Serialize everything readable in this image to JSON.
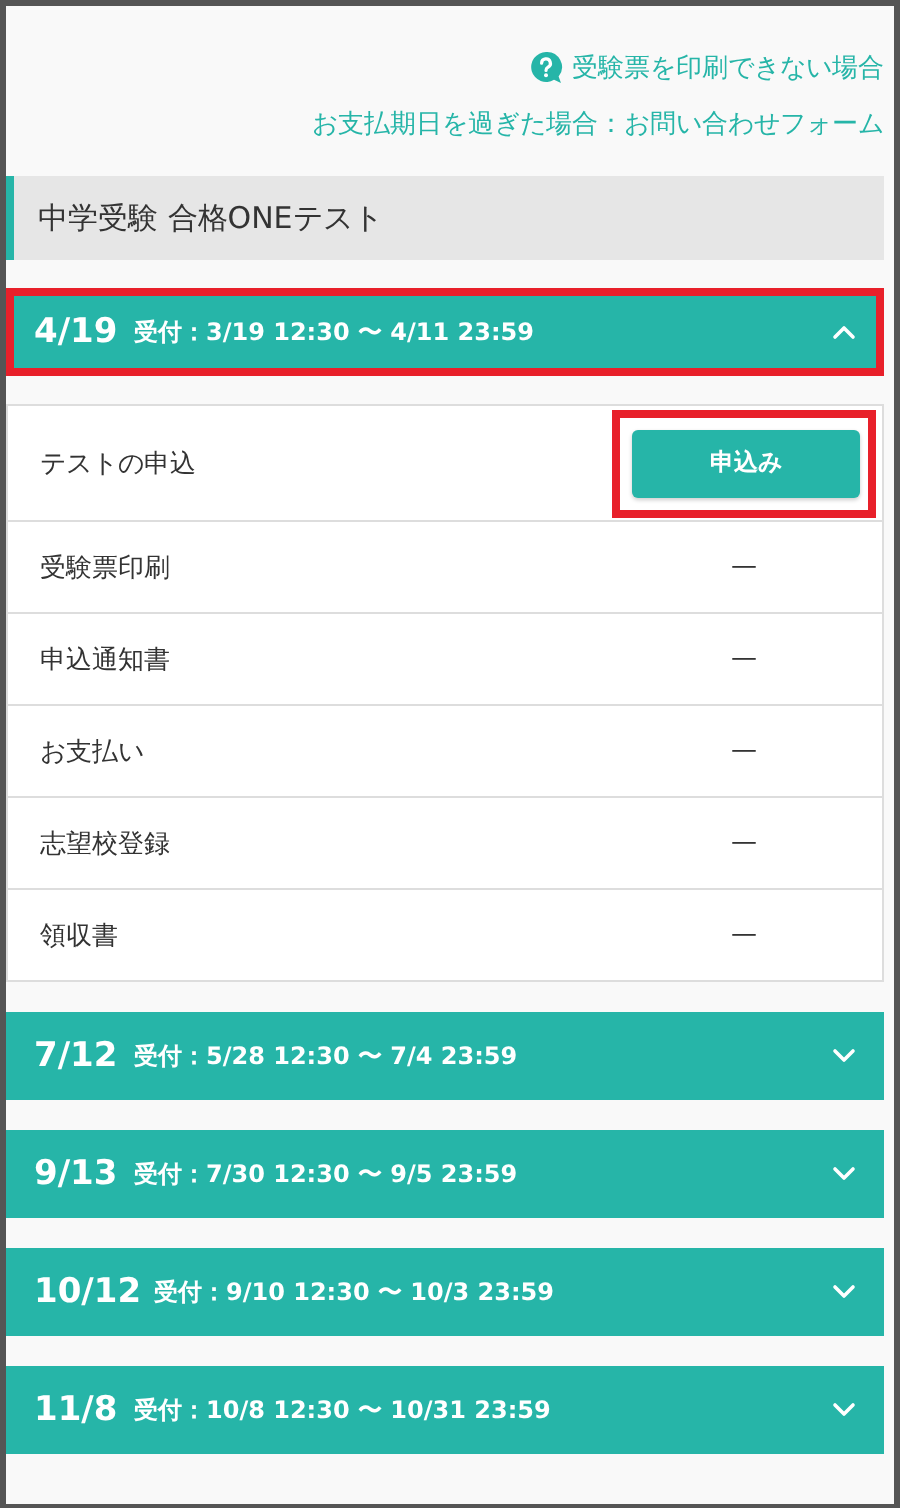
{
  "help_link": {
    "text": "受験票を印刷できない場合"
  },
  "contact_link": {
    "text": "お支払期日を過ぎた場合：お問い合わせフォーム"
  },
  "section_title": "中学受験 合格ONEテスト",
  "sessions": [
    {
      "date": "4/19",
      "period": "受付：3/19 12:30 〜 4/11 23:59",
      "expanded": true,
      "highlighted": true,
      "steps": [
        {
          "label": "テストの申込",
          "kind": "button",
          "action": "申込み",
          "highlighted": true
        },
        {
          "label": "受験票印刷",
          "kind": "dash",
          "status": "—"
        },
        {
          "label": "申込通知書",
          "kind": "dash",
          "status": "—"
        },
        {
          "label": "お支払い",
          "kind": "dash",
          "status": "—"
        },
        {
          "label": "志望校登録",
          "kind": "dash",
          "status": "—"
        },
        {
          "label": "領収書",
          "kind": "dash",
          "status": "—"
        }
      ]
    },
    {
      "date": "7/12",
      "period": "受付：5/28 12:30 〜 7/4 23:59",
      "expanded": false,
      "highlighted": false
    },
    {
      "date": "9/13",
      "period": "受付：7/30 12:30 〜 9/5 23:59",
      "expanded": false,
      "highlighted": false
    },
    {
      "date": "10/12",
      "period": "受付：9/10 12:30 〜 10/3 23:59",
      "expanded": false,
      "highlighted": false
    },
    {
      "date": "11/8",
      "period": "受付：10/8 12:30 〜 10/31 23:59",
      "expanded": false,
      "highlighted": false
    }
  ]
}
